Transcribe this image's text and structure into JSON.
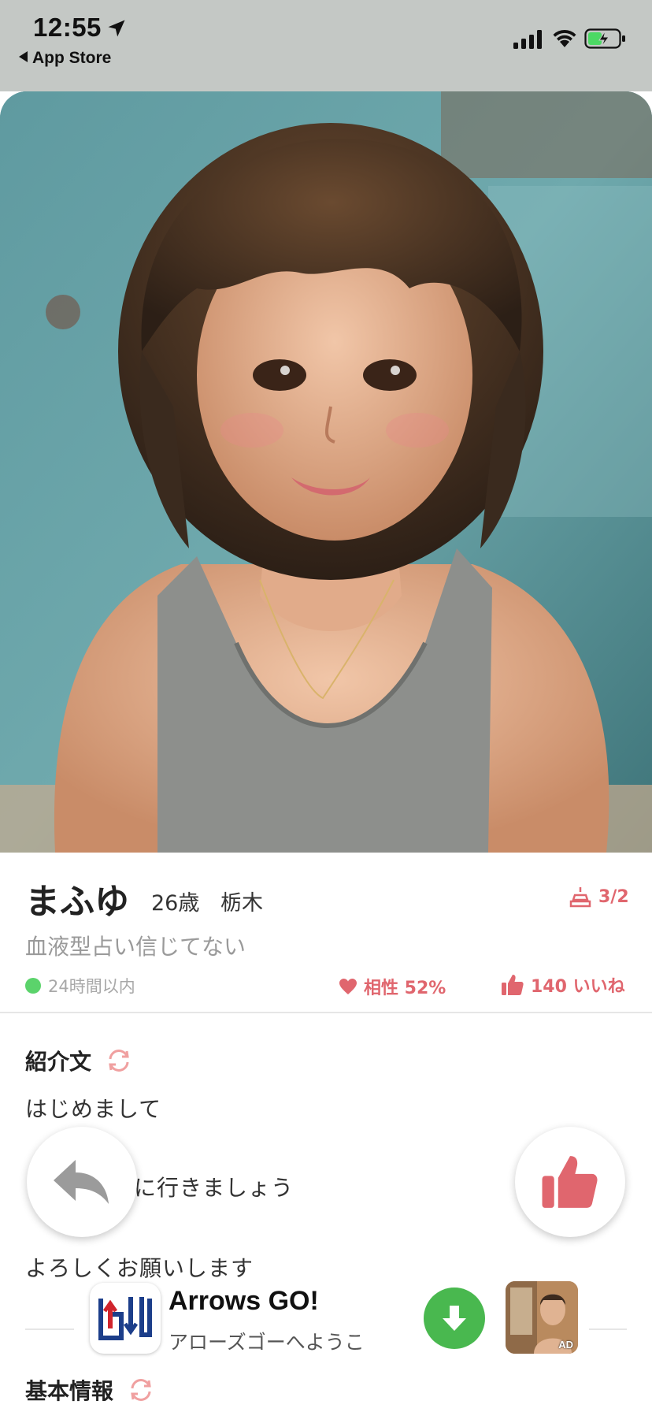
{
  "status_bar": {
    "time": "12:55",
    "back_app_label": "App Store",
    "icons": [
      "location-arrow-icon",
      "signal-icon",
      "wifi-icon",
      "battery-charging-icon"
    ]
  },
  "profile": {
    "name": "まふゆ",
    "age": "26歳",
    "prefecture": "栃木",
    "photo_count": "3/2",
    "tagline": "血液型占い信じてない",
    "online_status": "24時間以内",
    "compatibility": "相性 52%",
    "likes": "140 いいね"
  },
  "intro": {
    "title": "紹介文",
    "lines": [
      "はじめまして",
      "に行きましょう",
      "よろしくお願いします"
    ]
  },
  "ad": {
    "title": "Arrows GO!",
    "subtitle": "アローズゴーへようこ",
    "badge": "AD"
  },
  "basic_info": {
    "title": "基本情報"
  },
  "colors": {
    "accent": "#e0666e",
    "online": "#5bd36b",
    "download": "#49b84f",
    "status_bar_bg": "#c4c8c5"
  }
}
